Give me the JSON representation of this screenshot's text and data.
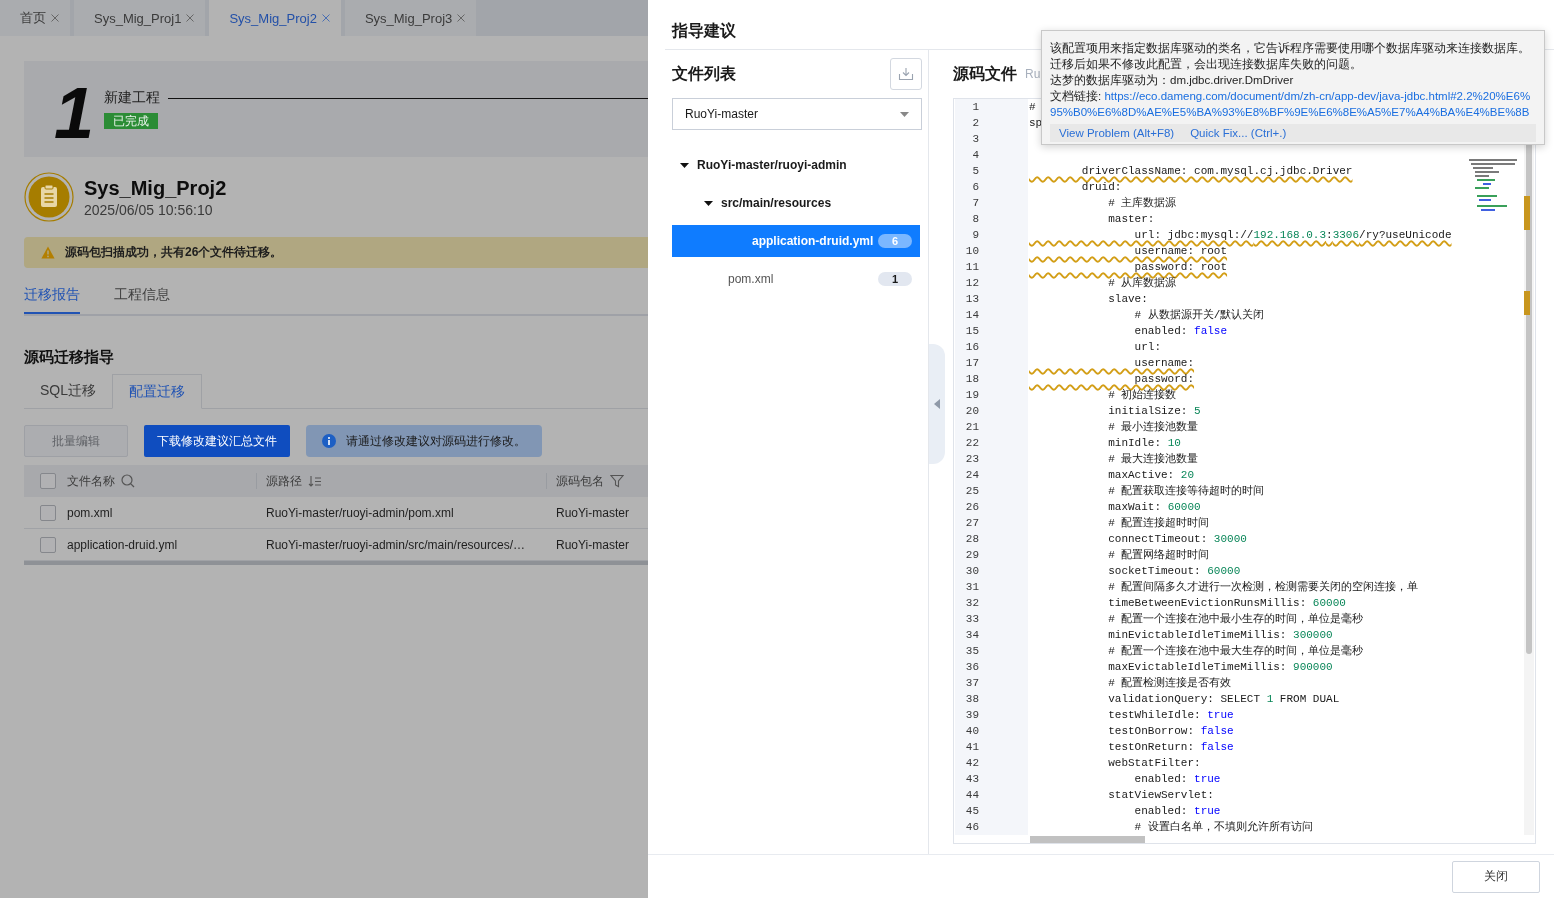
{
  "tab_bar": {
    "tabs": [
      {
        "label": "首页",
        "selected": false
      },
      {
        "label": "Sys_Mig_Proj1",
        "selected": false
      },
      {
        "label": "Sys_Mig_Proj2",
        "selected": true
      },
      {
        "label": "Sys_Mig_Proj3",
        "selected": false
      }
    ]
  },
  "step": {
    "number": "1",
    "title": "新建工程",
    "status": "已完成"
  },
  "project": {
    "name": "Sys_Mig_Proj2",
    "time": "2025/06/05 10:56:10"
  },
  "alert": {
    "kind": "warning",
    "text": "源码包扫描成功，共有26个文件待迁移。"
  },
  "report_tabs": [
    {
      "label": "迁移报告",
      "selected": true
    },
    {
      "label": "工程信息",
      "selected": false
    }
  ],
  "section_title": "源码迁移指导",
  "guide_tabs": [
    {
      "label": "SQL迁移",
      "selected": false
    },
    {
      "label": "配置迁移",
      "selected": true
    }
  ],
  "actions": [
    {
      "label": "批量编辑",
      "disabled": true
    },
    {
      "label": "下载修改建议汇总文件",
      "disabled": false
    }
  ],
  "notice": "请通过修改建议对源码进行修改。",
  "table": {
    "header_checked": false,
    "columns": [
      {
        "label": "文件名称",
        "kind": "search"
      },
      {
        "label": "源路径",
        "kind": "sort"
      },
      {
        "label": "源码包名",
        "kind": "filter"
      }
    ],
    "rows": [
      {
        "checked": false,
        "cells": [
          "pom.xml",
          "RuoYi-master/ruoyi-admin/pom.xml",
          "RuoYi-master"
        ]
      },
      {
        "checked": false,
        "cells": [
          "application-druid.yml",
          "RuoYi-master/ruoyi-admin/src/main/resources/…",
          "RuoYi-master"
        ]
      }
    ]
  },
  "drawer": {
    "title": "指导建议",
    "file_list_title": "文件列表",
    "package_select": "RuoYi-master",
    "tree": [
      {
        "label": "RuoYi-master/ruoyi-admin",
        "kind": "folder",
        "expanded": true,
        "selected": false,
        "children": [
          {
            "label": "src/main/resources",
            "kind": "folder",
            "expanded": true,
            "selected": false,
            "children": [
              {
                "label": "application-druid.yml",
                "kind": "file",
                "count": "6",
                "selected": true
              }
            ]
          },
          {
            "label": "pom.xml",
            "kind": "file",
            "count": "1",
            "selected": false
          }
        ]
      }
    ],
    "source_title": "源码文件",
    "source_path": "Ru",
    "editor": {
      "lines": [
        {
          "n": "1",
          "warn": false,
          "parts": [
            {
              "text": "#",
              "kind": "plain"
            }
          ]
        },
        {
          "n": "2",
          "warn": false,
          "parts": [
            {
              "text": "sp",
              "kind": "plain"
            }
          ]
        },
        {
          "n": "3",
          "warn": false
        },
        {
          "n": "4",
          "warn": false
        },
        {
          "n": "5",
          "warn": true,
          "parts": [
            {
              "text": "        driverClassName: com.mysql.cj.jdbc.Driver",
              "kind": "plain"
            }
          ]
        },
        {
          "n": "6",
          "warn": false,
          "parts": [
            {
              "text": "        druid:",
              "kind": "plain"
            }
          ]
        },
        {
          "n": "7",
          "warn": false,
          "parts": [
            {
              "text": "            # 主库数据源",
              "kind": "plain"
            }
          ]
        },
        {
          "n": "8",
          "warn": false,
          "parts": [
            {
              "text": "            master:",
              "kind": "plain"
            }
          ]
        },
        {
          "n": "9",
          "warn": true,
          "parts": [
            {
              "text": "                url: jdbc:mysql://",
              "kind": "plain"
            },
            {
              "text": "192.168.0.3",
              "kind": "number"
            },
            {
              "text": ":",
              "kind": "plain"
            },
            {
              "text": "3306",
              "kind": "number"
            },
            {
              "text": "/ry?useUnicode",
              "kind": "plain"
            }
          ]
        },
        {
          "n": "10",
          "warn": true,
          "parts": [
            {
              "text": "                username: root",
              "kind": "plain"
            }
          ]
        },
        {
          "n": "11",
          "warn": true,
          "parts": [
            {
              "text": "                password: root",
              "kind": "plain"
            }
          ]
        },
        {
          "n": "12",
          "warn": false,
          "parts": [
            {
              "text": "            # 从库数据源",
              "kind": "plain"
            }
          ]
        },
        {
          "n": "13",
          "warn": false,
          "parts": [
            {
              "text": "            slave:",
              "kind": "plain"
            }
          ]
        },
        {
          "n": "14",
          "warn": false,
          "parts": [
            {
              "text": "                # 从数据源开关/默认关闭",
              "kind": "plain"
            }
          ]
        },
        {
          "n": "15",
          "warn": false,
          "parts": [
            {
              "text": "                enabled: ",
              "kind": "plain"
            },
            {
              "text": "false",
              "kind": "keyword"
            }
          ]
        },
        {
          "n": "16",
          "warn": false,
          "parts": [
            {
              "text": "                url:",
              "kind": "plain"
            }
          ]
        },
        {
          "n": "17",
          "warn": true,
          "parts": [
            {
              "text": "                username:",
              "kind": "plain"
            }
          ]
        },
        {
          "n": "18",
          "warn": true,
          "parts": [
            {
              "text": "                password:",
              "kind": "plain"
            }
          ]
        },
        {
          "n": "19",
          "warn": false,
          "parts": [
            {
              "text": "            # 初始连接数",
              "kind": "plain"
            }
          ]
        },
        {
          "n": "20",
          "warn": false,
          "parts": [
            {
              "text": "            initialSize: ",
              "kind": "plain"
            },
            {
              "text": "5",
              "kind": "number"
            }
          ]
        },
        {
          "n": "21",
          "warn": false,
          "parts": [
            {
              "text": "            # 最小连接池数量",
              "kind": "plain"
            }
          ]
        },
        {
          "n": "22",
          "warn": false,
          "parts": [
            {
              "text": "            minIdle: ",
              "kind": "plain"
            },
            {
              "text": "10",
              "kind": "number"
            }
          ]
        },
        {
          "n": "23",
          "warn": false,
          "parts": [
            {
              "text": "            # 最大连接池数量",
              "kind": "plain"
            }
          ]
        },
        {
          "n": "24",
          "warn": false,
          "parts": [
            {
              "text": "            maxActive: ",
              "kind": "plain"
            },
            {
              "text": "20",
              "kind": "number"
            }
          ]
        },
        {
          "n": "25",
          "warn": false,
          "parts": [
            {
              "text": "            # 配置获取连接等待超时的时间",
              "kind": "plain"
            }
          ]
        },
        {
          "n": "26",
          "warn": false,
          "parts": [
            {
              "text": "            maxWait: ",
              "kind": "plain"
            },
            {
              "text": "60000",
              "kind": "number"
            }
          ]
        },
        {
          "n": "27",
          "warn": false,
          "parts": [
            {
              "text": "            # 配置连接超时时间",
              "kind": "plain"
            }
          ]
        },
        {
          "n": "28",
          "warn": false,
          "parts": [
            {
              "text": "            connectTimeout: ",
              "kind": "plain"
            },
            {
              "text": "30000",
              "kind": "number"
            }
          ]
        },
        {
          "n": "29",
          "warn": false,
          "parts": [
            {
              "text": "            # 配置网络超时时间",
              "kind": "plain"
            }
          ]
        },
        {
          "n": "30",
          "warn": false,
          "parts": [
            {
              "text": "            socketTimeout: ",
              "kind": "plain"
            },
            {
              "text": "60000",
              "kind": "number"
            }
          ]
        },
        {
          "n": "31",
          "warn": false,
          "parts": [
            {
              "text": "            # 配置间隔多久才进行一次检测，检测需要关闭的空闲连接，单",
              "kind": "plain"
            }
          ]
        },
        {
          "n": "32",
          "warn": false,
          "parts": [
            {
              "text": "            timeBetweenEvictionRunsMillis: ",
              "kind": "plain"
            },
            {
              "text": "60000",
              "kind": "number"
            }
          ]
        },
        {
          "n": "33",
          "warn": false,
          "parts": [
            {
              "text": "            # 配置一个连接在池中最小生存的时间，单位是毫秒",
              "kind": "plain"
            }
          ]
        },
        {
          "n": "34",
          "warn": false,
          "parts": [
            {
              "text": "            minEvictableIdleTimeMillis: ",
              "kind": "plain"
            },
            {
              "text": "300000",
              "kind": "number"
            }
          ]
        },
        {
          "n": "35",
          "warn": false,
          "parts": [
            {
              "text": "            # 配置一个连接在池中最大生存的时间，单位是毫秒",
              "kind": "plain"
            }
          ]
        },
        {
          "n": "36",
          "warn": false,
          "parts": [
            {
              "text": "            maxEvictableIdleTimeMillis: ",
              "kind": "plain"
            },
            {
              "text": "900000",
              "kind": "number"
            }
          ]
        },
        {
          "n": "37",
          "warn": false,
          "parts": [
            {
              "text": "            # 配置检测连接是否有效",
              "kind": "plain"
            }
          ]
        },
        {
          "n": "38",
          "warn": false,
          "parts": [
            {
              "text": "            validationQuery: SELECT ",
              "kind": "plain"
            },
            {
              "text": "1",
              "kind": "number"
            },
            {
              "text": " FROM DUAL",
              "kind": "plain"
            }
          ]
        },
        {
          "n": "39",
          "warn": false,
          "parts": [
            {
              "text": "            testWhileIdle: ",
              "kind": "plain"
            },
            {
              "text": "true",
              "kind": "keyword"
            }
          ]
        },
        {
          "n": "40",
          "warn": false,
          "parts": [
            {
              "text": "            testOnBorrow: ",
              "kind": "plain"
            },
            {
              "text": "false",
              "kind": "keyword"
            }
          ]
        },
        {
          "n": "41",
          "warn": false,
          "parts": [
            {
              "text": "            testOnReturn: ",
              "kind": "plain"
            },
            {
              "text": "false",
              "kind": "keyword"
            }
          ]
        },
        {
          "n": "42",
          "warn": false,
          "parts": [
            {
              "text": "            webStatFilter:",
              "kind": "plain"
            }
          ]
        },
        {
          "n": "43",
          "warn": false,
          "parts": [
            {
              "text": "                enabled: ",
              "kind": "plain"
            },
            {
              "text": "true",
              "kind": "keyword"
            }
          ]
        },
        {
          "n": "44",
          "warn": false,
          "parts": [
            {
              "text": "            statViewServlet:",
              "kind": "plain"
            }
          ]
        },
        {
          "n": "45",
          "warn": false,
          "parts": [
            {
              "text": "                enabled: ",
              "kind": "plain"
            },
            {
              "text": "true",
              "kind": "keyword"
            }
          ]
        },
        {
          "n": "46",
          "warn": false,
          "parts": [
            {
              "text": "                # 设置白名单，不填则允许所有访问",
              "kind": "plain"
            }
          ]
        }
      ]
    },
    "tooltip": {
      "lines": [
        "该配置项用来指定数据库驱动的类名，它告诉程序需要使用哪个数据库驱动来连接数据库。",
        "迁移后如果不修改此配置，会出现连接数据库失败的问题。",
        "达梦的数据库驱动为：dm.jdbc.driver.DmDriver"
      ],
      "doc_label": "文档链接:",
      "doc_link": "https://eco.dameng.com/document/dm/zh-cn/app-dev/java-jdbc.html#2.2%20%E6%95%B0%E6%8D%AE%E5%BA%93%E8%BF%9E%E6%8E%A5%E7%A4%BA%E4%BE%8B",
      "actions": [
        "View Problem (Alt+F8)",
        "Quick Fix... (Ctrl+.)"
      ]
    },
    "close_button": "关闭"
  }
}
